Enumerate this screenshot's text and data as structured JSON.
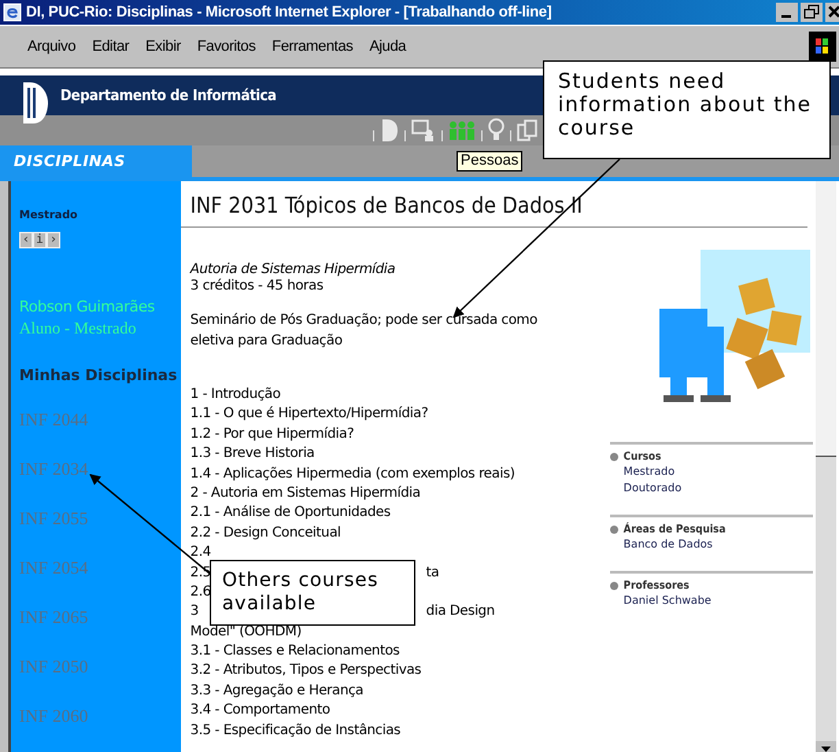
{
  "window": {
    "title": "DI, PUC-Rio: Disciplinas - Microsoft Internet Explorer - [Trabalhando off-line]"
  },
  "menu": [
    "Arquivo",
    "Editar",
    "Exibir",
    "Favoritos",
    "Ferramentas",
    "Ajuda"
  ],
  "site_header": {
    "title": "Departamento de Informática",
    "section": "DISCIPLINAS",
    "toolbar": [
      {
        "kind": "logo",
        "selected": false
      },
      {
        "kind": "board",
        "selected": false
      },
      {
        "kind": "people",
        "selected": true
      },
      {
        "kind": "bulb",
        "selected": false
      },
      {
        "kind": "documents",
        "selected": false
      }
    ],
    "tooltip": "Pessoas"
  },
  "sidebar": {
    "level": "Mestrado",
    "nav": [
      "‹",
      "i",
      "›"
    ],
    "user_name": "Robson Guimarães",
    "user_role": "Aluno - Mestrado",
    "heading": "Minhas Disciplinas",
    "courses": [
      "INF 2044",
      "INF 2034",
      "INF 2055",
      "INF 2054",
      "INF 2065",
      "INF 2050",
      "INF 2060"
    ]
  },
  "content": {
    "title": "INF 2031 Tópicos de Bancos de Dados II",
    "subtitle": "Autoria de Sistemas Hipermídia",
    "credits": "3 créditos - 45 horas",
    "description": "Seminário de Pós Graduação; pode ser cursada como eletiva para Graduação",
    "outline": [
      {
        "text": "1 - Introdução"
      },
      {
        "text": "1.1 - O que é Hipertexto/Hipermídia?"
      },
      {
        "text": "1.2 - Por que Hipermídia?"
      },
      {
        "text": "1.3 - Breve Historia"
      },
      {
        "text": "1.4 - Aplicações Hipermedia (com exemplos reais)"
      },
      {
        "text": "2 - Autoria em Sistemas Hipermídia"
      },
      {
        "text": "2.1 - Análise de Oportunidades"
      },
      {
        "text": "2.2 - Design Conceitual"
      },
      {
        "text": "2.4"
      },
      {
        "text": "2.5",
        "tail": "ta"
      },
      {
        "text": "2.6"
      },
      {
        "text": "3",
        "tail": "dia Design"
      },
      {
        "text": "Model\" (OOHDM)"
      },
      {
        "text": "3.1 - Classes e Relacionamentos"
      },
      {
        "text": "3.2 - Atributos, Tipos e Perspectivas"
      },
      {
        "text": "3.3 - Agregação e Herança"
      },
      {
        "text": "3.4 - Comportamento"
      },
      {
        "text": "3.5 - Especificação de Instâncias"
      }
    ],
    "related": [
      {
        "title": "Cursos",
        "links": [
          "Mestrado",
          "Doutorado"
        ]
      },
      {
        "title": "Áreas de Pesquisa",
        "links": [
          "Banco de Dados"
        ]
      },
      {
        "title": "Professores",
        "links": [
          "Daniel Schwabe"
        ]
      }
    ]
  },
  "annotations": [
    {
      "text": "Students need information about the course"
    },
    {
      "text": "Others courses available"
    }
  ]
}
